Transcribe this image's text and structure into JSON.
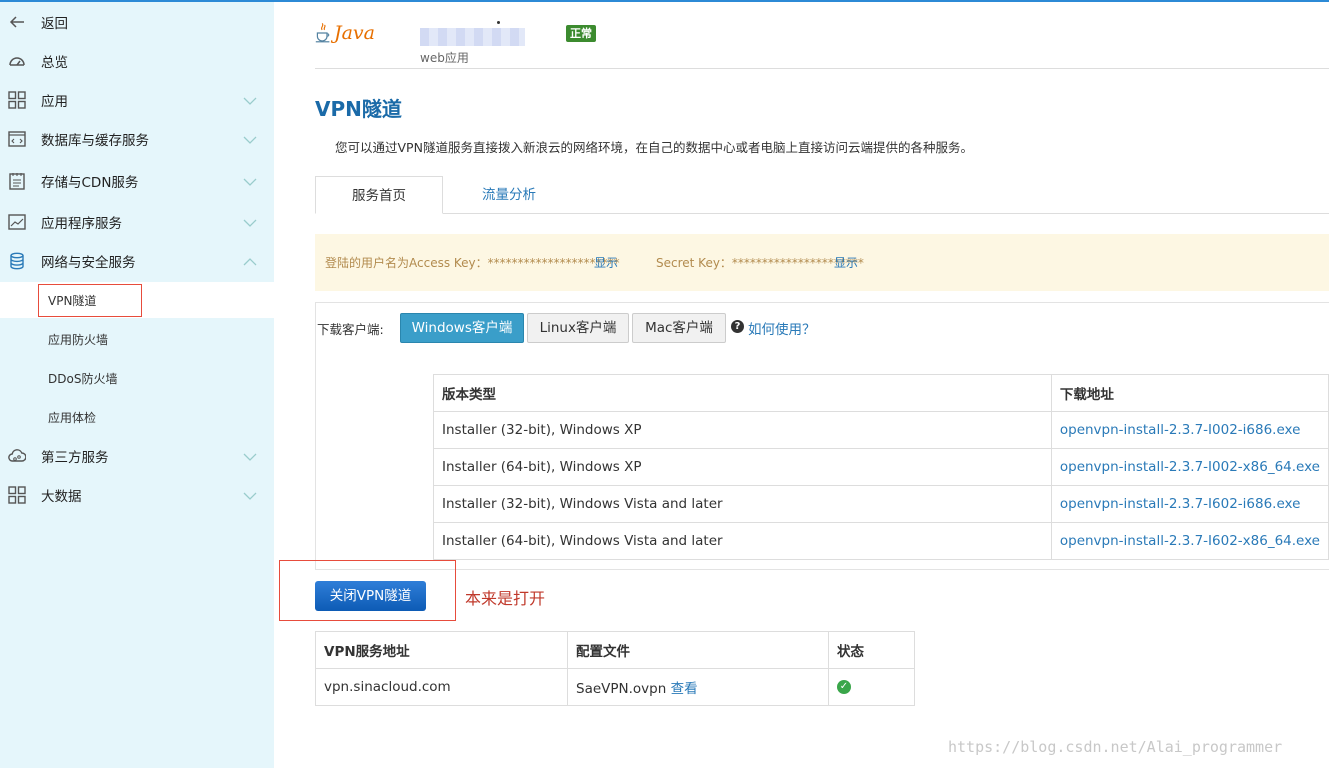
{
  "sidebar": {
    "back": "返回",
    "items": [
      {
        "label": "总览",
        "icon": "dashboard-icon"
      },
      {
        "label": "应用",
        "icon": "grid-icon"
      },
      {
        "label": "数据库与缓存服务",
        "icon": "code-window-icon"
      },
      {
        "label": "存储与CDN服务",
        "icon": "clipboard-icon"
      },
      {
        "label": "应用程序服务",
        "icon": "chart-window-icon"
      },
      {
        "label": "网络与安全服务",
        "icon": "database-icon"
      },
      {
        "label": "第三方服务",
        "icon": "cloud-icon"
      },
      {
        "label": "大数据",
        "icon": "grid-icon"
      }
    ],
    "sub_items": [
      "VPN隧道",
      "应用防火墙",
      "DDoS防火墙",
      "应用体检"
    ]
  },
  "header": {
    "logo_text": "Java",
    "app_type": "web应用",
    "status": "正常",
    "status_color": "#3c8b2f"
  },
  "page": {
    "title": "VPN隧道",
    "description": "您可以通过VPN隧道服务直接拨入新浪云的网络环境，在自己的数据中心或者电脑上直接访问云端提供的各种服务。"
  },
  "tabs": [
    "服务首页",
    "流量分析"
  ],
  "keys": {
    "access_label": "登陆的用户名为Access Key：**********************",
    "access_link": "显示",
    "secret_label": "Secret Key：**********************",
    "secret_link": "显示"
  },
  "download": {
    "label": "下载客户端:",
    "buttons": [
      "Windows客户端",
      "Linux客户端",
      "Mac客户端"
    ],
    "help": "如何使用？",
    "headers": [
      "版本类型",
      "下载地址"
    ],
    "rows": [
      [
        "Installer (32-bit), Windows XP",
        "openvpn-install-2.3.7-I002-i686.exe"
      ],
      [
        "Installer (64-bit), Windows XP",
        "openvpn-install-2.3.7-I002-x86_64.exe"
      ],
      [
        "Installer (32-bit), Windows Vista and later",
        "openvpn-install-2.3.7-I602-i686.exe"
      ],
      [
        "Installer (64-bit), Windows Vista and later",
        "openvpn-install-2.3.7-I602-x86_64.exe"
      ]
    ]
  },
  "close_button": "关闭VPN隧道",
  "annotation": "本来是打开",
  "vpn": {
    "headers": [
      "VPN服务地址",
      "配置文件",
      "状态"
    ],
    "address": "vpn.sinacloud.com",
    "config_file": "SaeVPN.ovpn",
    "view_link": "查看",
    "status_icon": "check-circle-icon"
  },
  "watermark": "https://blog.csdn.net/Alai_programmer",
  "accent_color": "#1a6aa8"
}
